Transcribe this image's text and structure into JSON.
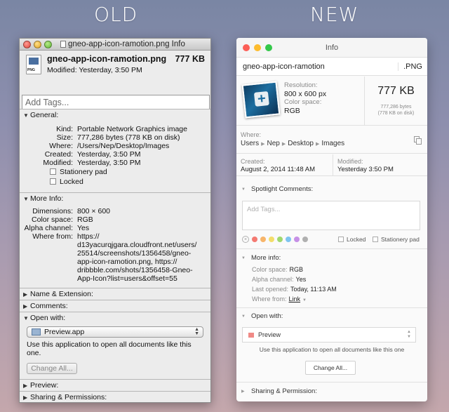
{
  "headings": {
    "old": "OLD",
    "new": "NEW"
  },
  "old": {
    "window_title": "gneo-app-icon-ramotion.png Info",
    "file_icon_label": "PNG",
    "file_name": "gneo-app-icon-ramotion.png",
    "file_size": "777 KB",
    "modified": "Modified: Yesterday, 3:50 PM",
    "tags_placeholder": "Add Tags...",
    "general": {
      "title": "General:",
      "rows": [
        {
          "k": "Kind:",
          "v": "Portable Network Graphics image"
        },
        {
          "k": "Size:",
          "v": "777,286 bytes (778 KB on disk)"
        },
        {
          "k": "Where:",
          "v": "/Users/Nep/Desktop/Images"
        },
        {
          "k": "Created:",
          "v": "Yesterday, 3:50 PM"
        },
        {
          "k": "Modified:",
          "v": "Yesterday, 3:50 PM"
        }
      ],
      "stationery": "Stationery pad",
      "locked": "Locked"
    },
    "more_info": {
      "title": "More Info:",
      "dimensions_k": "Dimensions:",
      "dimensions_v": "800 × 600",
      "colorspace_k": "Color space:",
      "colorspace_v": "RGB",
      "alpha_k": "Alpha channel:",
      "alpha_v": "Yes",
      "where_from_k": "Where from:",
      "where_from_lines": [
        "https://",
        "d13yacurqjgara.cloudfront.net/users/",
        "25514/screenshots/1356458/gneo-",
        "app-icon-ramotion.png, https://",
        "dribbble.com/shots/1356458-Gneo-",
        "App-Icon?list=users&offset=55"
      ]
    },
    "name_ext": "Name & Extension:",
    "comments": "Comments:",
    "open_with": {
      "title": "Open with:",
      "app": "Preview.app",
      "note": "Use this application to open all documents like this one.",
      "change_all": "Change All..."
    },
    "preview": "Preview:",
    "sharing": "Sharing & Permissions:"
  },
  "new": {
    "window_title": "Info",
    "file_name": "gneo-app-icon-ramotion",
    "file_ext": ".PNG",
    "resolution_label": "Resolution:",
    "resolution": "800 x 600 px",
    "colorspace_label": "Color space:",
    "colorspace": "RGB",
    "size": "777 KB",
    "bytes": "777,286 bytes",
    "on_disk": "(778 KB on disk)",
    "where_label": "Where:",
    "path": [
      "Users",
      "Nep",
      "Desktop",
      "Images"
    ],
    "created_label": "Created:",
    "created": "August 2, 2014 11:48 AM",
    "modified_label": "Modified:",
    "modified": "Yesterday 3:50 PM",
    "spotlight_title": "Spotlight Comments:",
    "tags_placeholder": "Add Tags...",
    "tag_colors": [
      "#f47a72",
      "#f7b56a",
      "#f3dd6a",
      "#9fd86f",
      "#7ec4f0",
      "#c690e6",
      "#b0b0b0"
    ],
    "locked": "Locked",
    "stationery": "Stationery pad",
    "more_title": "More info:",
    "more": {
      "colorspace_l": "Color space:",
      "colorspace_v": "RGB",
      "alpha_l": "Alpha channel:",
      "alpha_v": "Yes",
      "opened_l": "Last opened:",
      "opened_v": "Today, 11:13 AM",
      "from_l": "Where from:",
      "from_v": "Link"
    },
    "open_title": "Open with:",
    "app": "Preview",
    "note": "Use this application to open all documents like this one",
    "change_all": "Change All...",
    "sharing": "Sharing & Permission:"
  }
}
